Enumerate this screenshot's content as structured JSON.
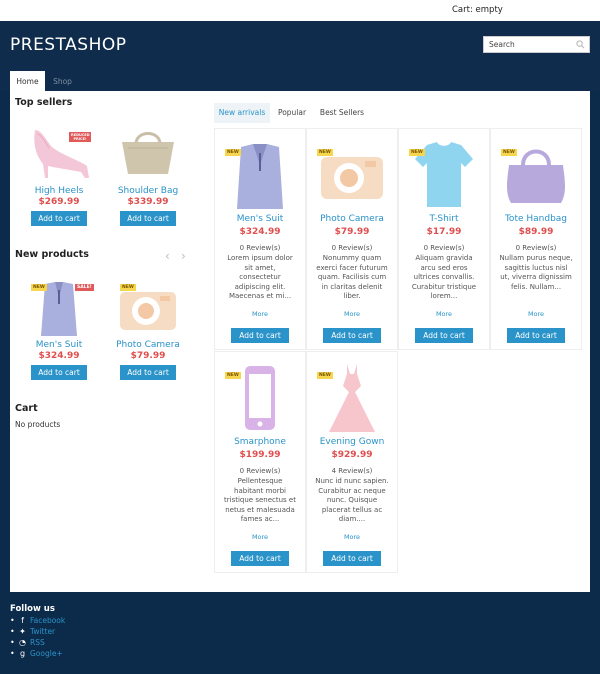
{
  "topbar": {
    "cart_label": "Cart: empty"
  },
  "header": {
    "logo": "PRESTASHOP",
    "search_placeholder": "Search"
  },
  "nav": {
    "home": "Home",
    "shop": "Shop"
  },
  "sidebar": {
    "top_sellers_title": "Top sellers",
    "top_sellers": [
      {
        "name": "High Heels",
        "price": "$269.99",
        "button": "Add to cart",
        "badge": "REDUCED PRICE!"
      },
      {
        "name": "Shoulder Bag",
        "price": "$339.99",
        "button": "Add to cart"
      }
    ],
    "new_products_title": "New products",
    "new_products": [
      {
        "name": "Men's Suit",
        "price": "$324.99",
        "button": "Add to cart",
        "badge_new": "NEW",
        "badge_sale": "SALE!"
      },
      {
        "name": "Photo Camera",
        "price": "$79.99",
        "button": "Add to cart",
        "badge_new": "NEW"
      }
    ],
    "cart_title": "Cart",
    "cart_empty": "No products"
  },
  "tabs": {
    "new_arrivals": "New arrivals",
    "popular": "Popular",
    "best_sellers": "Best Sellers"
  },
  "products": [
    {
      "name": "Men's Suit",
      "price": "$324.99",
      "reviews": "0 Review(s)",
      "desc": "Lorem ipsum dolor sit amet, consectetur adipiscing elit. Maecenas et mi...",
      "more": "More",
      "button": "Add to cart",
      "badge": "NEW"
    },
    {
      "name": "Photo Camera",
      "price": "$79.99",
      "reviews": "0 Review(s)",
      "desc": "Nonummy quam exerci facer futurum quam. Facilisis cum in claritas delenit liber.",
      "more": "More",
      "button": "Add to cart",
      "badge": "NEW"
    },
    {
      "name": "T-Shirt",
      "price": "$17.99",
      "reviews": "0 Review(s)",
      "desc": "Aliquam gravida arcu sed eros ultrices convallis. Curabitur tristique lorem...",
      "more": "More",
      "button": "Add to cart",
      "badge": "NEW"
    },
    {
      "name": "Tote Handbag",
      "price": "$89.99",
      "reviews": "0 Review(s)",
      "desc": "Nullam purus neque, sagittis luctus nisl ut, viverra dignissim felis. Nullam...",
      "more": "More",
      "button": "Add to cart",
      "badge": "NEW"
    },
    {
      "name": "Smarphone",
      "price": "$199.99",
      "reviews": "0 Review(s)",
      "desc": "Pellentesque habitant morbi tristique senectus et netus et malesuada fames ac...",
      "more": "More",
      "button": "Add to cart",
      "badge": "NEW"
    },
    {
      "name": "Evening Gown",
      "price": "$929.99",
      "reviews": "4 Review(s)",
      "desc": "Nunc id nunc sapien. Curabitur ac neque nunc. Quisque placerat tellus ac diam....",
      "more": "More",
      "button": "Add to cart",
      "badge": "NEW"
    }
  ],
  "footer": {
    "follow_title": "Follow us",
    "links": [
      {
        "label": "Facebook",
        "icon": "facebook-icon"
      },
      {
        "label": "Twitter",
        "icon": "twitter-icon"
      },
      {
        "label": "RSS",
        "icon": "rss-icon"
      },
      {
        "label": "Google+",
        "icon": "google-plus-icon"
      }
    ]
  },
  "colors": {
    "header_bg": "#0f2c4c",
    "accent": "#2a93c9",
    "price": "#e04e4e",
    "badge_new": "#f6d54f"
  }
}
